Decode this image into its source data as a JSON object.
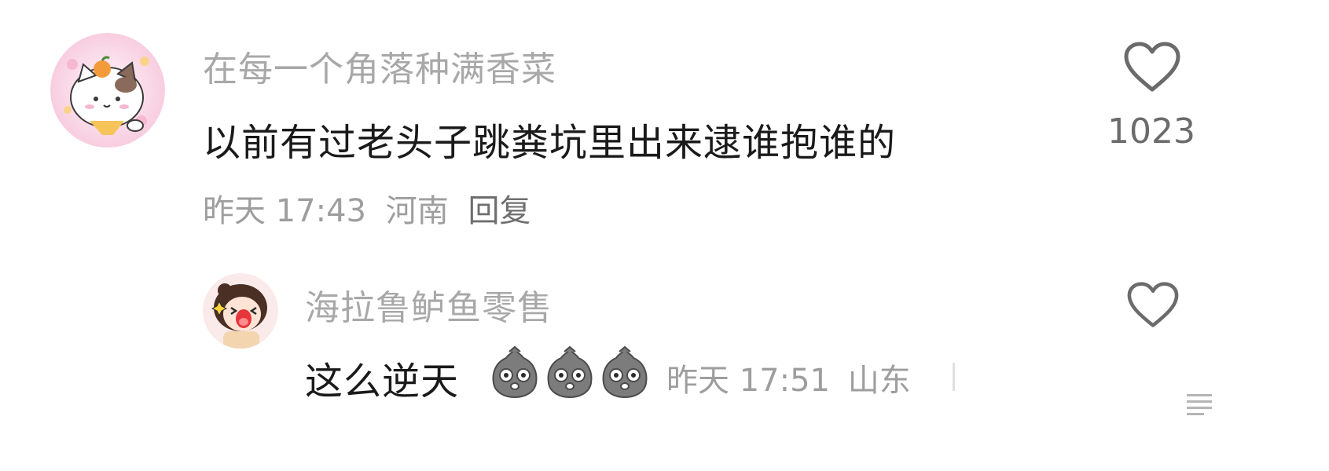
{
  "comment": {
    "username": "在每一个角落种满香菜",
    "text": "以前有过老头子跳粪坑里出来逮谁抱谁的",
    "time": "昨天 17:43",
    "location": "河南",
    "reply_label": "回复",
    "like_count": "1023",
    "like_icon": "heart-outline-icon",
    "avatar_icon": "cat-avatar-icon"
  },
  "reply": {
    "username": "海拉鲁鲈鱼零售",
    "text": "这么逆天",
    "emojis": [
      "stunned-face-icon",
      "stunned-face-icon",
      "stunned-face-icon"
    ],
    "time": "昨天 17:51",
    "location": "山东",
    "like_icon": "heart-outline-icon",
    "avatar_icon": "girl-avatar-icon"
  },
  "colors": {
    "username": "#a8a8a8",
    "content": "#1a1a1a",
    "meta": "#9e9e9e",
    "icon": "#6b6b6b"
  }
}
